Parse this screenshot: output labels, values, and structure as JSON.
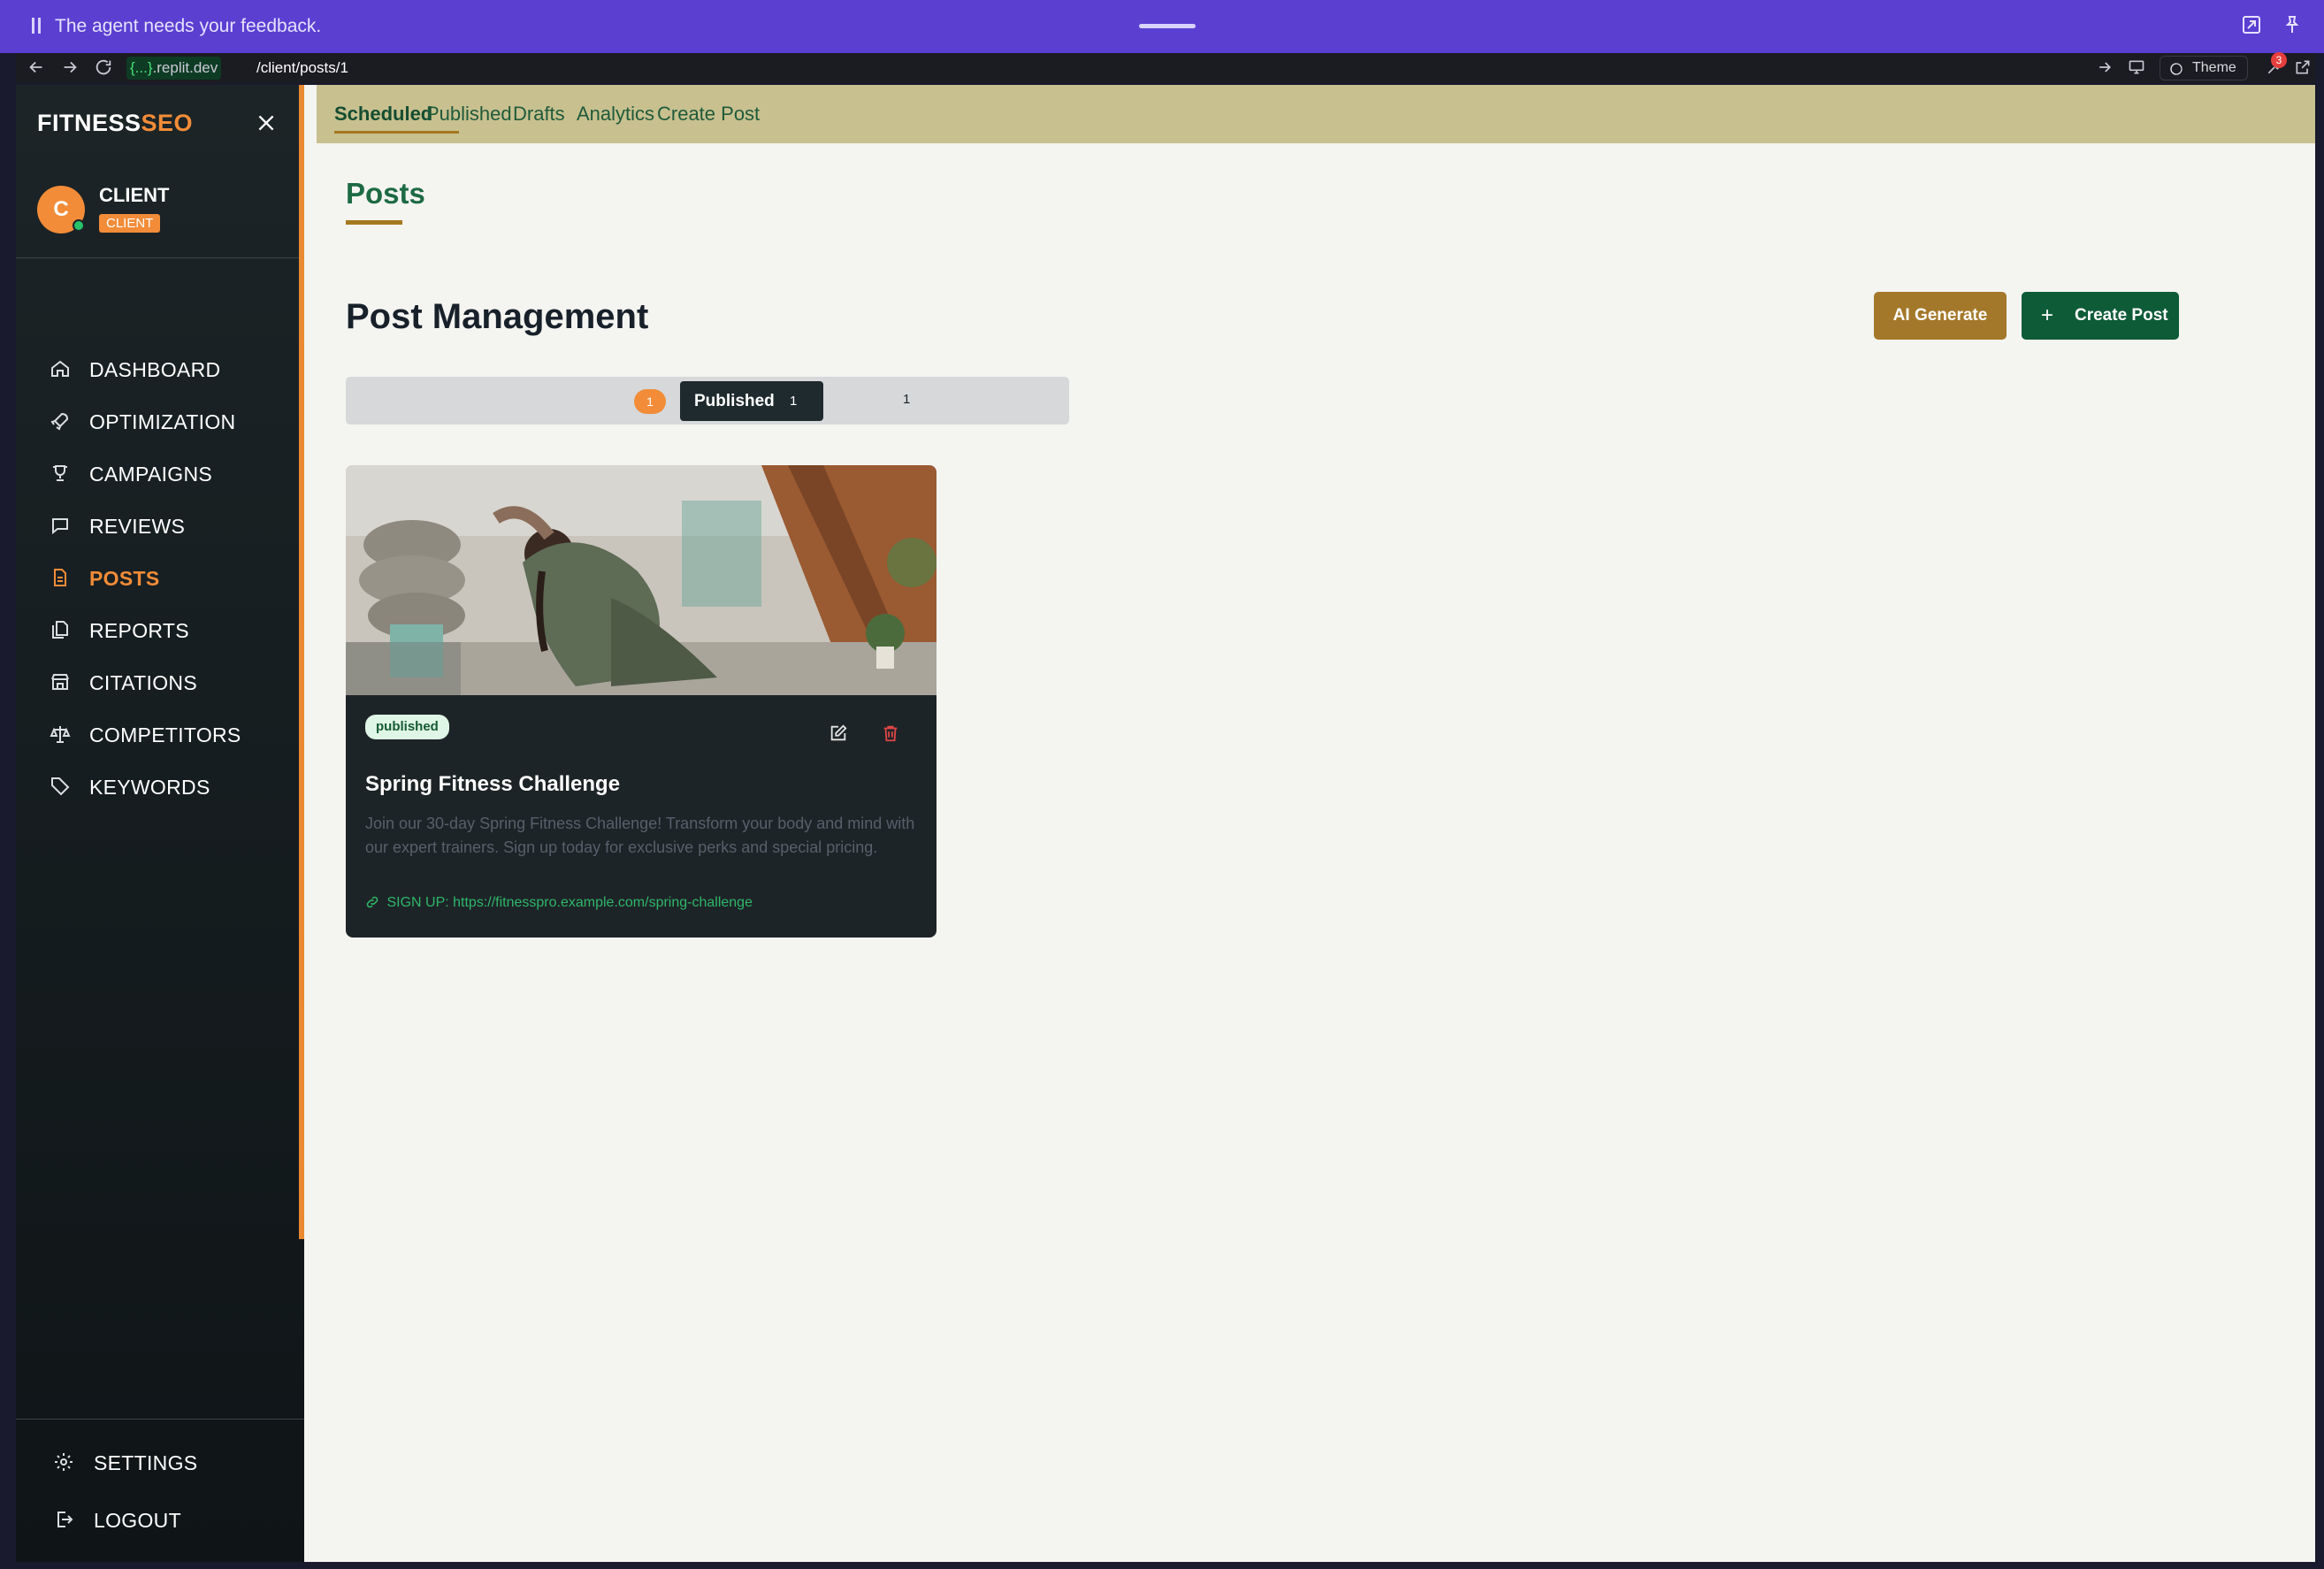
{
  "agent_bar": {
    "message": "The agent needs your feedback."
  },
  "browser": {
    "host_prefix": "{...}",
    "host_domain": ".replit.dev",
    "path": "/client/posts/1",
    "theme_label": "Theme",
    "notification_count": "3"
  },
  "brand": {
    "part1": "FITNESS",
    "part2": "SEO"
  },
  "user": {
    "initial": "C",
    "name": "CLIENT",
    "role": "CLIENT"
  },
  "sidebar": {
    "items": [
      {
        "label": "DASHBOARD",
        "icon": "home-icon"
      },
      {
        "label": "OPTIMIZATION",
        "icon": "rocket-icon"
      },
      {
        "label": "CAMPAIGNS",
        "icon": "trophy-icon"
      },
      {
        "label": "REVIEWS",
        "icon": "message-icon"
      },
      {
        "label": "POSTS",
        "icon": "document-icon",
        "active": true
      },
      {
        "label": "REPORTS",
        "icon": "files-icon"
      },
      {
        "label": "CITATIONS",
        "icon": "store-icon"
      },
      {
        "label": "COMPETITORS",
        "icon": "scale-icon"
      },
      {
        "label": "KEYWORDS",
        "icon": "tag-icon"
      }
    ],
    "settings_label": "SETTINGS",
    "logout_label": "LOGOUT"
  },
  "tabs": [
    "Scheduled",
    "Published",
    "Drafts",
    "Analytics",
    "Create Post"
  ],
  "page": {
    "title": "Posts",
    "section_title": "Post Management",
    "ai_generate_label": "AI Generate",
    "create_post_label": "Create Post"
  },
  "filter": {
    "scheduled_count": "1",
    "published_label": "Published",
    "published_count": "1",
    "drafts_count": "1"
  },
  "post": {
    "status": "published",
    "title": "Spring Fitness Challenge",
    "body": "Join our 30-day Spring Fitness Challenge! Transform your body and mind with our expert trainers. Sign up today for exclusive perks and special pricing.",
    "link": "SIGN UP: https://fitnesspro.example.com/spring-challenge"
  },
  "colors": {
    "accent_orange": "#f28c38",
    "brand_green": "#0d5b37",
    "gold": "#a4782a",
    "agent_purple": "#5a3fd1"
  }
}
